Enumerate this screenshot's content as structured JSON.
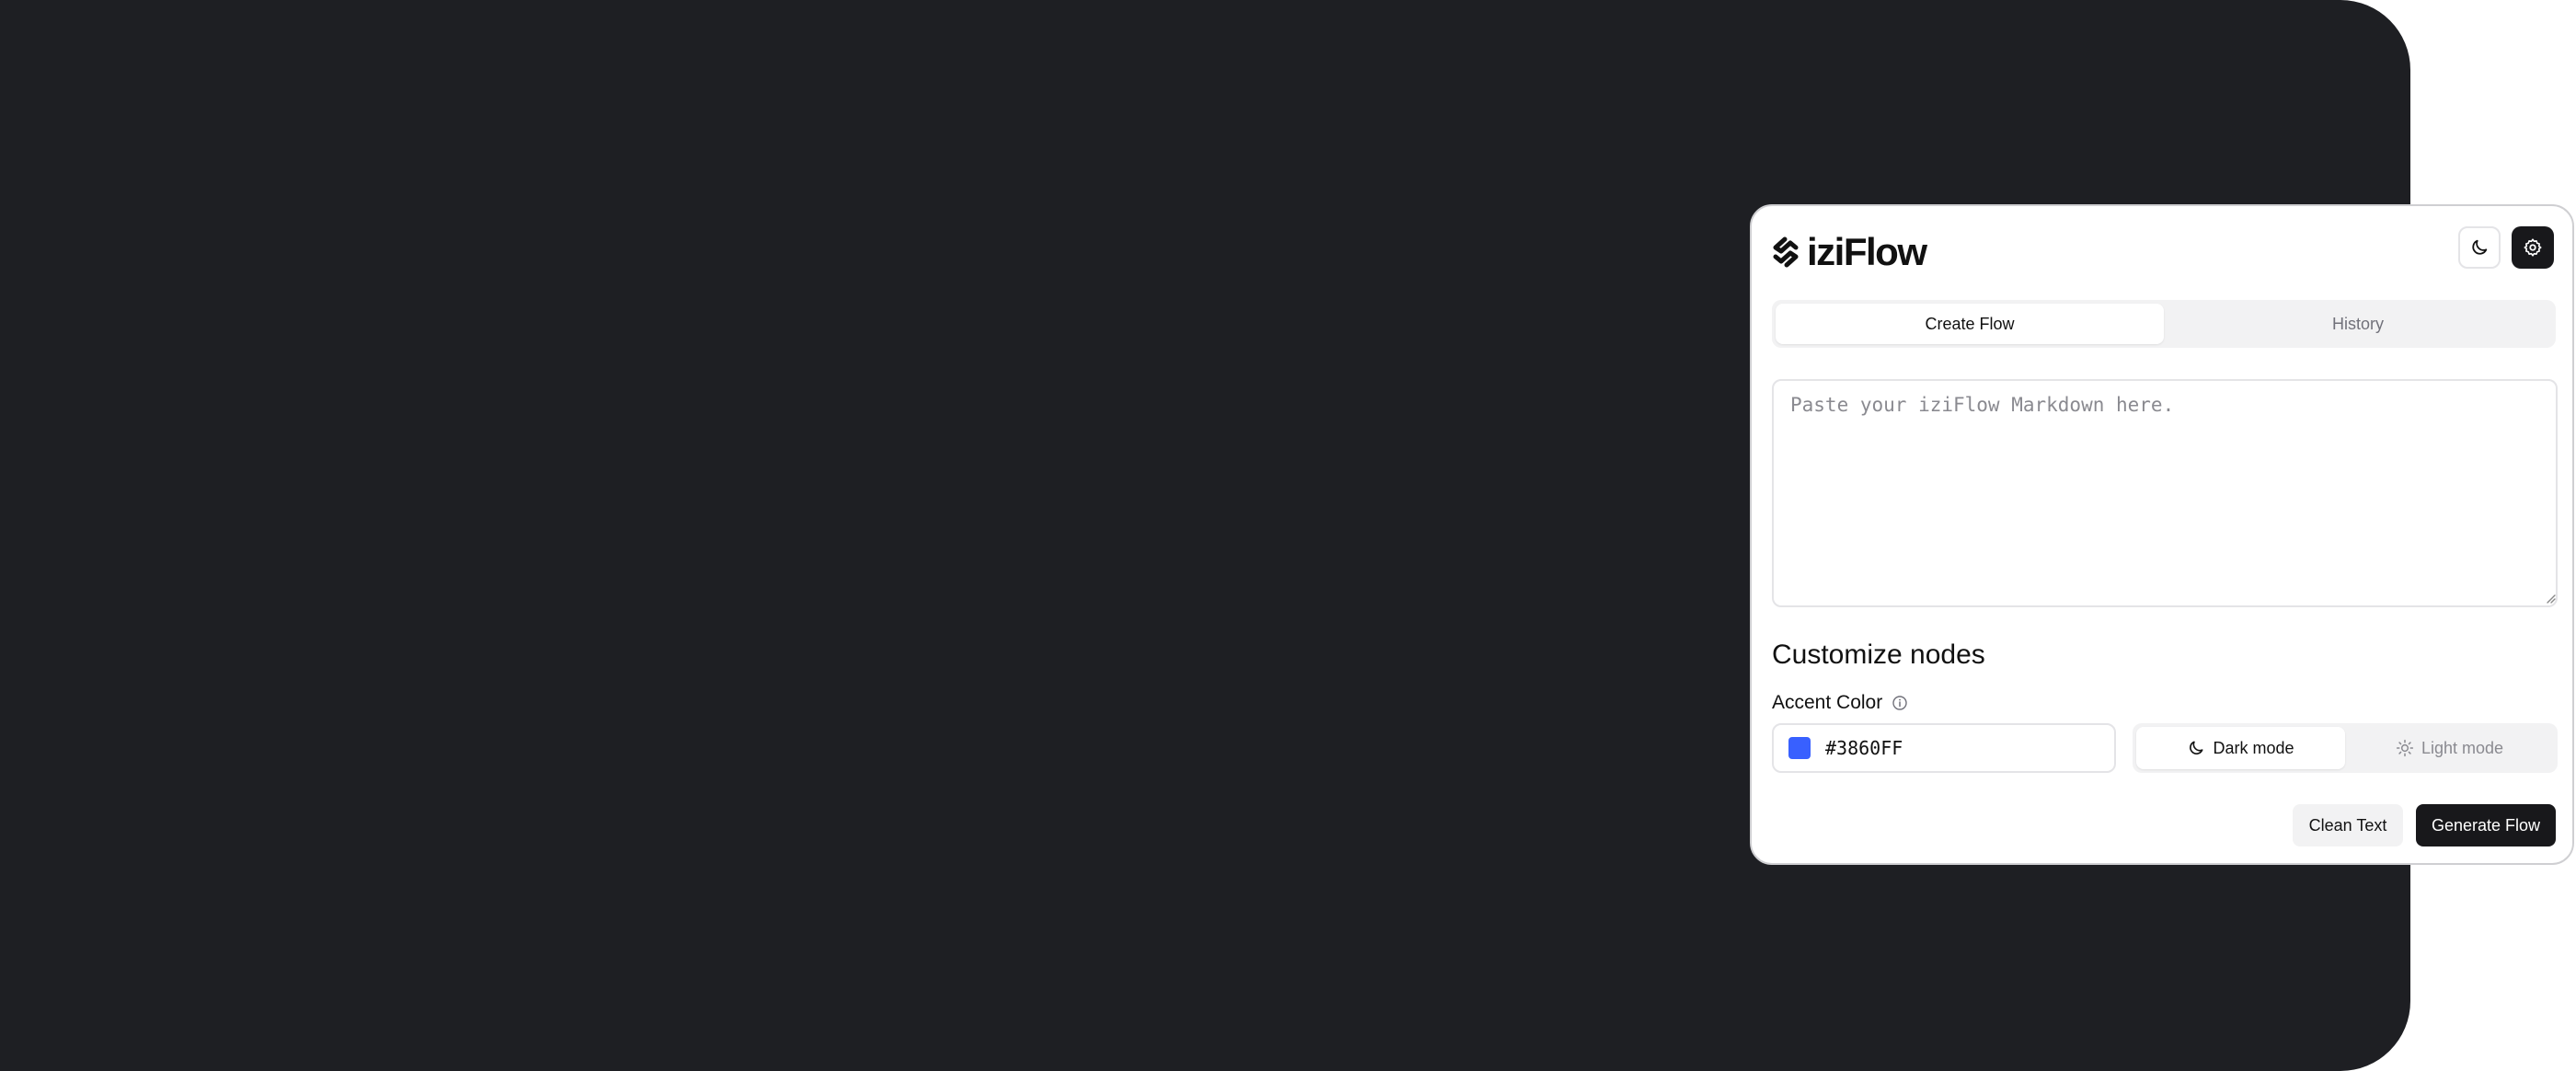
{
  "app": {
    "logo_text": "iziFlow"
  },
  "header": {
    "theme_toggle_icon": "moon-icon",
    "settings_icon": "gear-icon"
  },
  "tabs": [
    {
      "label": "Create Flow",
      "active": true
    },
    {
      "label": "History",
      "active": false
    }
  ],
  "editor": {
    "placeholder": "Paste your iziFlow Markdown here.",
    "value": ""
  },
  "customize": {
    "title": "Customize nodes",
    "accent_label": "Accent Color",
    "accent_value": "#3860FF",
    "accent_hex": "#3860FF",
    "modes": [
      {
        "label": "Dark mode",
        "icon": "moon-icon",
        "active": true
      },
      {
        "label": "Light mode",
        "icon": "sun-icon",
        "active": false
      }
    ]
  },
  "actions": {
    "clean_label": "Clean Text",
    "generate_label": "Generate Flow"
  },
  "colors": {
    "canvas_bg": "#1e1f23",
    "primary_dark": "#18181b"
  }
}
